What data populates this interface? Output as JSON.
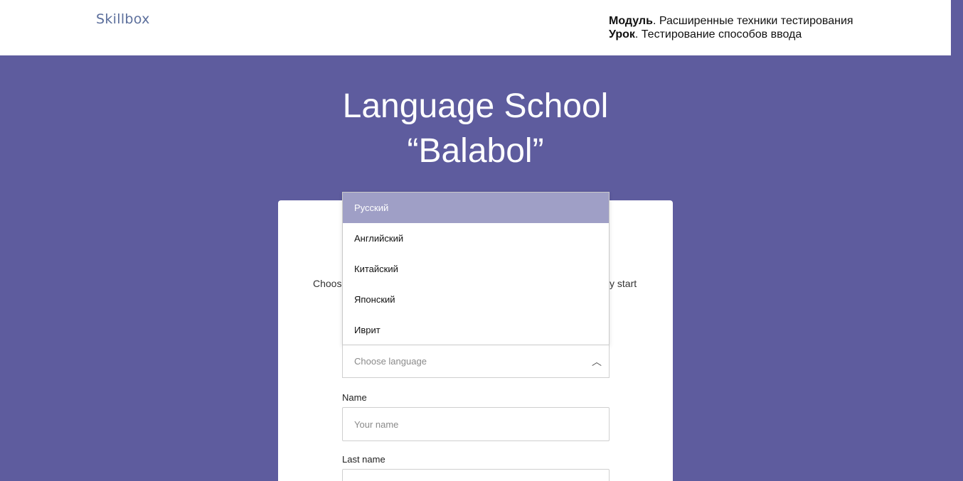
{
  "header": {
    "logo": "Skillbox",
    "module_label": "Модуль",
    "module_value": ". Расширенные техники тестирования",
    "lesson_label": "Урок",
    "lesson_value": ". Тестирование способов ввода"
  },
  "hero": {
    "title_line1": "Language School",
    "title_line2": "“Balabol”"
  },
  "form": {
    "intro_left": "Choose",
    "intro_right": "y start",
    "language": {
      "placeholder": "Choose language",
      "options": [
        "Русский",
        "Английский",
        "Китайский",
        "Японский",
        "Иврит"
      ],
      "selected_index": 0,
      "chevron": "︿"
    },
    "name_label": "Name",
    "name_placeholder": "Your name",
    "lastname_label": "Last name",
    "lastname_placeholder": ""
  },
  "colors": {
    "background": "#5e5c9e",
    "highlight": "#9f9fc6"
  }
}
